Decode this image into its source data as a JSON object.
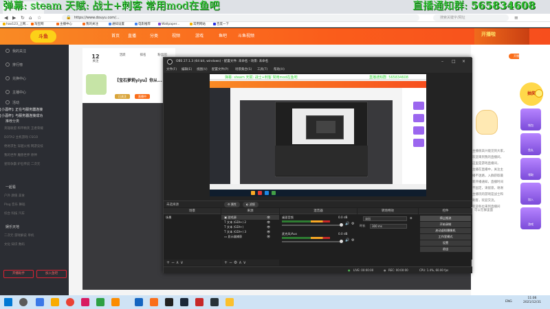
{
  "overlay": {
    "left_text": "弹幕: steam 天赋: 战士+刺客 常用mod在鱼吧",
    "right_prefix": "直播通知群:",
    "right_number": "565834608"
  },
  "browser": {
    "url": "https://www.douyu.com/...",
    "search_placeholder": "搜索关键字/网址",
    "bookmarks": [
      "hao123_上网...",
      "淘宝网",
      "主播中心",
      "我的关注",
      "通知设置",
      "电影推荐",
      "Wallpaper...",
      "常用网站",
      "百度一下"
    ]
  },
  "douyu": {
    "logo": "斗鱼",
    "nav": [
      "首页",
      "直播",
      "分类",
      "视频",
      "游戏",
      "鱼吧",
      "斗鱼视频"
    ],
    "top_right_banner": "开播啦",
    "sidebar": {
      "items": [
        "我的关注",
        "排行榜",
        "兑换中心",
        "主播中心",
        "活动"
      ],
      "section_two": "推荐分类",
      "grid_rows": [
        [
          "英雄联盟",
          "和平精英",
          "王者荣耀"
        ],
        [
          "DOTA2",
          "主机游戏",
          "CSGO"
        ],
        [
          "绝地求生",
          "穿越火线",
          "网游竞技"
        ],
        [
          "我的世界",
          "魔兽世界",
          "原神"
        ],
        [
          "星际争霸",
          "炉石传说",
          "二次元"
        ]
      ],
      "section_three": "一起看",
      "grid_rows_b": [
        [
          "户外",
          "颜值",
          "美食"
        ],
        [
          "Plog",
          "音乐",
          "舞蹈"
        ],
        [
          "综合",
          "科技",
          "汽车"
        ]
      ],
      "section_four": "娱乐天地",
      "grid_rows_c": [
        [
          "二次元",
          "游戏解说",
          "单机"
        ],
        [
          "文化",
          "知识",
          "数码"
        ]
      ],
      "buttons": [
        "开播助手",
        "加入鱼吧"
      ]
    },
    "room": {
      "stats": [
        {
          "value": "12",
          "label": "关注"
        },
        {
          "value": "",
          "label": "活跃"
        },
        {
          "value": "",
          "label": "排名"
        },
        {
          "value": "",
          "label": "粉丝团"
        }
      ],
      "title": "【宝石萝莉yiyu】你从...",
      "badges": [
        "已关注",
        "直播中"
      ]
    },
    "player_lines": [
      "[小酒杯]: 正在与服务器连接",
      "[小酒杯]: 与服务器连接成功"
    ],
    "right_notice": "开播通知",
    "right_lines": [
      "主播很高兴能见到大家，",
      "欢迎来到我的直播间，",
      "这里是游戏直播间，",
      "主播在直播中，关注主",
      "播不迷路，入群获取最",
      "新开播通知，直播时间",
      "不固定，请留意，谢谢",
      "主播玩的游戏是战士和",
      "刺客，欢迎交流。",
      "欢迎各位来到直播间"
    ],
    "right_footer": "可以在群里面",
    "promo": [
      "钱包",
      "鱼丸",
      "领取",
      "加入",
      "游戏"
    ]
  },
  "obs": {
    "title": "OBS 27.1.3 (64 bit, windows) - 配置文件: 未命名 - 场景: 未命名",
    "menu": [
      "文件(F)",
      "编辑(E)",
      "视图(V)",
      "配置文件(P)",
      "场景集合(S)",
      "工具(T)",
      "帮助(H)"
    ],
    "section_label": "未选择源",
    "prop_buttons": [
      "属性",
      "滤镜"
    ],
    "docks": [
      "场景",
      "来源",
      "混音器",
      "转场特效",
      "控件"
    ],
    "scenes": [
      "场景"
    ],
    "sources": [
      "游戏源",
      "文本 (GDI+) 2",
      "文本 (GDI+)",
      "文本 (GDI+) 3",
      "显示器捕获"
    ],
    "mixer": [
      {
        "name": "桌面音频",
        "db": "0.0 dB"
      },
      {
        "name": "麦克风/Aux",
        "db": "0.0 dB"
      }
    ],
    "transition": {
      "type": "淡出",
      "duration_label": "时长",
      "duration": "300 ms"
    },
    "controls": [
      "停止推流",
      "开始录制",
      "启动虚拟摄像机",
      "工作室模式",
      "设置",
      "退出"
    ],
    "status": {
      "live": "LIVE: 00:00:00",
      "rec": "REC: 00:00:00",
      "cpu": "CPU: 1.4%, 60.00 fps"
    }
  },
  "taskbar": {
    "lang": "ENG",
    "time": "11:06",
    "date": "2021/12/31"
  },
  "nested": {
    "green_left": "弹幕: steam 天赋: 战士+刺客 常用mod在鱼吧",
    "green_right": "直播通知群: 565834608"
  },
  "colors": {
    "overlay_green": "#36d93a",
    "douyu_orange": "#fa6e1a",
    "obs_dark": "#1f1f1f"
  }
}
